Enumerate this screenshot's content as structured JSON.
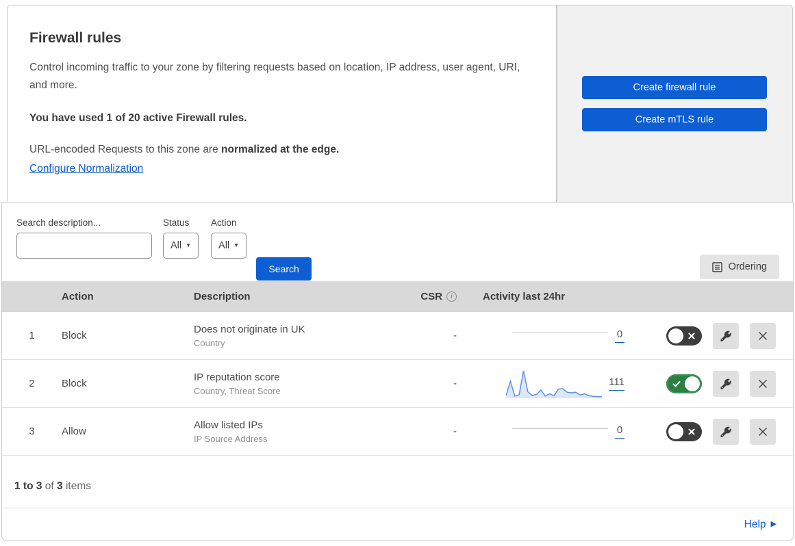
{
  "intro": {
    "title": "Firewall rules",
    "description": "Control incoming traffic to your zone by filtering requests based on location, IP address, user agent, URI, and more.",
    "usage": "You have used 1 of 20 active Firewall rules.",
    "normalization_text": "URL-encoded Requests to this zone are ",
    "normalization_bold": "normalized at the edge.",
    "normalization_link": "Configure Normalization"
  },
  "actions_panel": {
    "create_firewall_label": "Create firewall rule",
    "create_mtls_label": "Create mTLS rule"
  },
  "filters": {
    "search_label": "Search description...",
    "search_value": "",
    "status_label": "Status",
    "status_value": "All",
    "action_label": "Action",
    "action_value": "All",
    "search_button": "Search",
    "ordering_button": "Ordering"
  },
  "table": {
    "headers": {
      "action": "Action",
      "description": "Description",
      "csr": "CSR",
      "csr_info_icon": "i",
      "activity": "Activity last 24hr"
    },
    "rows": [
      {
        "num": "1",
        "action": "Block",
        "description": "Does not originate in UK",
        "fields": "Country",
        "csr": "-",
        "activity_count": "0",
        "enabled": false,
        "sparkline": null
      },
      {
        "num": "2",
        "action": "Block",
        "description": "IP reputation score",
        "fields": "Country, Threat Score",
        "csr": "-",
        "activity_count": "111",
        "enabled": true,
        "sparkline": [
          10,
          62,
          8,
          12,
          100,
          24,
          10,
          14,
          30,
          8,
          16,
          9,
          33,
          35,
          22,
          20,
          22,
          12,
          16,
          9,
          7,
          6,
          5
        ]
      },
      {
        "num": "3",
        "action": "Allow",
        "description": "Allow listed IPs",
        "fields": "IP Source Address",
        "csr": "-",
        "activity_count": "0",
        "enabled": false,
        "sparkline": null
      }
    ]
  },
  "footer": {
    "range": "1 to 3",
    "of_text": "of",
    "total": "3",
    "items_text": "items",
    "help_label": "Help"
  },
  "colors": {
    "accent_blue": "#0d5dd3",
    "toggle_on_green": "#2d7e43",
    "toggle_off_gray": "#3d3d3d",
    "sparkline_line": "#5f8fe0",
    "sparkline_fill": "#dce7f7",
    "panel_gray": "#f1f1f1",
    "table_header_gray": "#d9d9d9"
  }
}
